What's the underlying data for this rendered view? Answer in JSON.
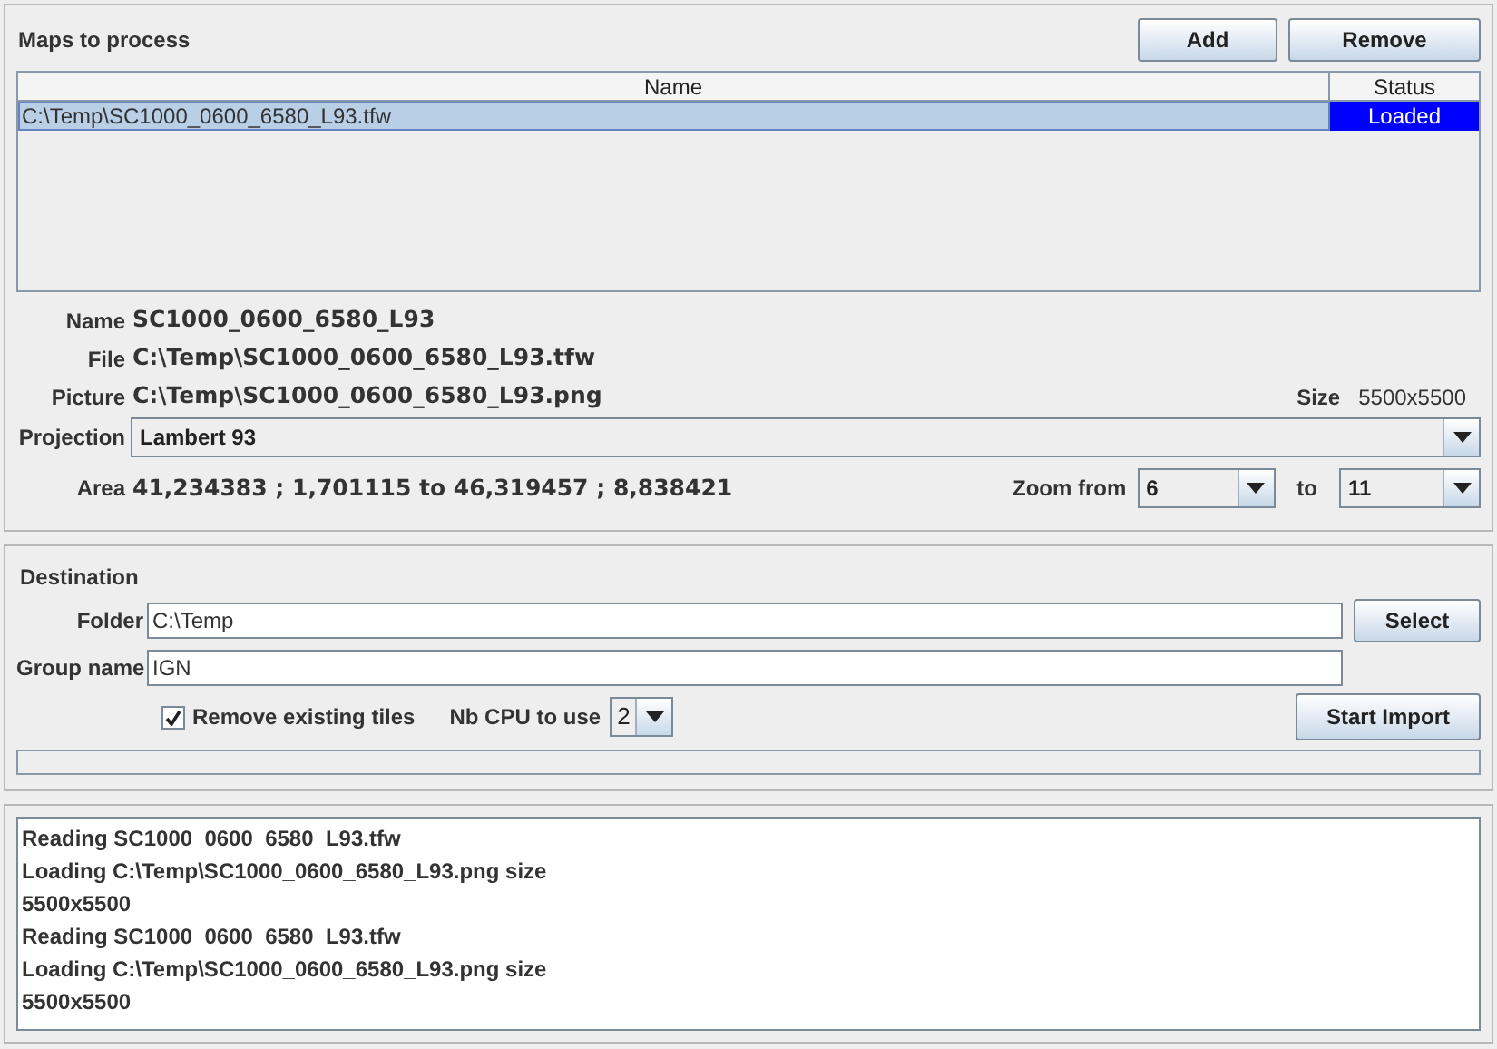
{
  "maps_panel": {
    "title": "Maps to process",
    "buttons": [
      "Add",
      "Remove"
    ],
    "table": {
      "columns": [
        "Name",
        "Status"
      ],
      "rows": [
        {
          "name": "C:\\Temp\\SC1000_0600_6580_L93.tfw",
          "status": "Loaded",
          "selected": true
        }
      ]
    },
    "details": [
      {
        "label": "Name",
        "value": "SC1000_0600_6580_L93"
      },
      {
        "label": "File",
        "value": "C:\\Temp\\SC1000_0600_6580_L93.tfw"
      },
      {
        "label": "Picture",
        "value": "C:\\Temp\\SC1000_0600_6580_L93.png"
      }
    ],
    "size": {
      "label": "Size",
      "value": "5500x5500"
    },
    "projection": {
      "label": "Projection",
      "value": "Lambert 93"
    },
    "area": {
      "label": "Area",
      "value": "41,234383 ; 1,701115 to 46,319457 ; 8,838421"
    },
    "zoom": {
      "label_from": "Zoom from",
      "from": "6",
      "label_to": "to",
      "to": "11"
    }
  },
  "destination_panel": {
    "title": "Destination",
    "folder": {
      "label": "Folder",
      "value": "C:\\Temp",
      "button": "Select"
    },
    "group_name": {
      "label": "Group name",
      "value": "IGN"
    },
    "remove_existing": {
      "label": "Remove existing tiles",
      "checked": true
    },
    "cpu": {
      "label": "Nb CPU to use",
      "value": "2"
    },
    "start_button": "Start Import",
    "progress": {
      "level": 0
    }
  },
  "log": [
    "Reading SC1000_0600_6580_L93.tfw",
    "Loading C:\\Temp\\SC1000_0600_6580_L93.png size",
    "5500x5500",
    "Reading SC1000_0600_6580_L93.tfw",
    "Loading C:\\Temp\\SC1000_0600_6580_L93.png size",
    "5500x5500"
  ]
}
